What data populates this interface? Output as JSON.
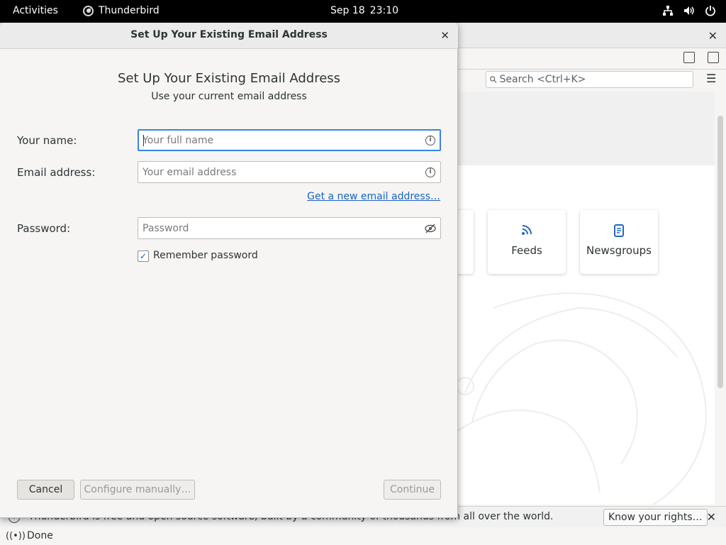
{
  "topbar": {
    "activities": "Activities",
    "app_name": "Thunderbird",
    "date": "Sep 18",
    "time": "23:10",
    "tray_icons": [
      "network-icon",
      "volume-icon",
      "power-icon"
    ]
  },
  "main": {
    "search_placeholder": "Search <Ctrl+K>",
    "tiles": [
      {
        "label": "Feeds",
        "icon": "rss-icon"
      },
      {
        "label": "Newsgroups",
        "icon": "newsgroup-icon"
      }
    ],
    "notification": {
      "text": "Thunderbird is free and open source software, built by a community of thousands from all over the world.",
      "button": "Know your rights…"
    },
    "status": "Done"
  },
  "dialog": {
    "title": "Set Up Your Existing Email Address",
    "heading": "Set Up Your Existing Email Address",
    "subheading": "Use your current email address",
    "name_label": "Your name:",
    "name_placeholder": "Your full name",
    "email_label": "Email address:",
    "email_placeholder": "Your email address",
    "new_email_link": "Get a new email address…",
    "password_label": "Password:",
    "password_placeholder": "Password",
    "remember_label": "Remember password",
    "remember_checked": true,
    "cancel": "Cancel",
    "configure_manually": "Configure manually…",
    "continue": "Continue"
  },
  "colors": {
    "accent": "#3584e4",
    "link": "#1a62c4",
    "topbar": "#000000"
  }
}
